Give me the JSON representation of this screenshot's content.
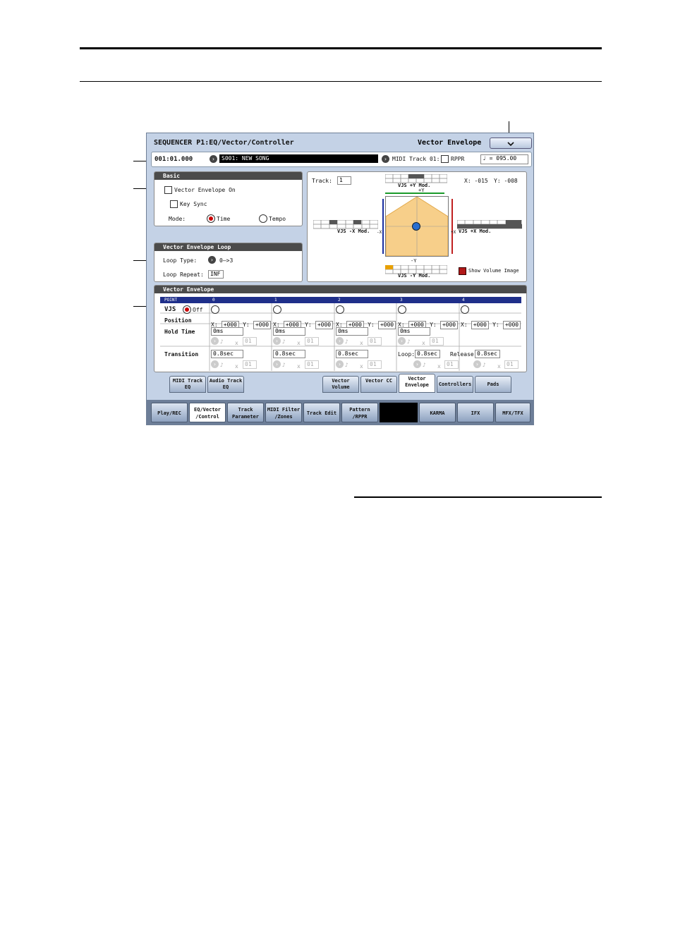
{
  "screen": {
    "title": "SEQUENCER P1:EQ/Vector/Controller",
    "page_menu": "Vector Envelope",
    "location": "001:01.000",
    "song": "S001: NEW SONG",
    "midi_track": "MIDI Track 01:",
    "rppr_label": "RPPR",
    "tempo": "095.00",
    "basic": {
      "header": "Basic",
      "vector_env_on": "Vector Envelope On",
      "key_sync": "Key Sync",
      "mode_label": "Mode:",
      "mode_time": "Time",
      "mode_tempo": "Tempo"
    },
    "loop": {
      "header": "Vector Envelope Loop",
      "loop_type_label": "Loop Type:",
      "loop_type": "0–>3",
      "loop_repeat_label": "Loop Repeat:",
      "loop_repeat": "INF"
    },
    "graph": {
      "track_label": "Track:",
      "track": "1",
      "x_readout": "X: -015",
      "y_readout": "Y: -008",
      "plus_y_mod": "VJS +Y Mod.",
      "minus_y_mod": "VJS -Y Mod.",
      "minus_x_mod": "VJS -X Mod.",
      "plus_x_mod": "VJS +X Mod.",
      "plus_y": "+Y",
      "minus_y": "-Y",
      "minus_x": "-X",
      "plus_x": "+X",
      "show_volume": "Show Volume Image"
    },
    "env": {
      "header": "Vector Envelope",
      "point_label": "POINT",
      "points": [
        "0",
        "1",
        "2",
        "3",
        "4"
      ],
      "vjs_label": "VJS",
      "vjs_off": "Off",
      "position_label": "Position",
      "x_prefix": "X:",
      "y_prefix": "Y:",
      "positions": [
        {
          "x": "+000",
          "y": "+000"
        },
        {
          "x": "+000",
          "y": "+000"
        },
        {
          "x": "+000",
          "y": "+000"
        },
        {
          "x": "+000",
          "y": "+000"
        },
        {
          "x": "+000",
          "y": "+000"
        }
      ],
      "hold_label": "Hold Time",
      "holds": [
        "0ms",
        "0ms",
        "0ms",
        "0ms"
      ],
      "times_sym": "x",
      "mult": "01",
      "transition_label": "Transition",
      "transitions": [
        "0.8sec",
        "0.8sec",
        "0.8sec"
      ],
      "loop_t_label": "Loop:",
      "loop_t": "0.8sec",
      "release_label": "Release:",
      "release_t": "0.8sec"
    },
    "tabs": [
      "MIDI Track EQ",
      "Audio Track EQ",
      "Vector Volume",
      "Vector CC",
      "Vector Envelope",
      "Controllers",
      "Pads"
    ],
    "bottom_tabs": [
      "Play/REC",
      "EQ/Vector /Control",
      "Track Parameter",
      "MIDI Filter /Zones",
      "Track Edit",
      "Pattern /RPPR",
      "KARMA",
      "IFX",
      "MFX/TFX"
    ]
  }
}
